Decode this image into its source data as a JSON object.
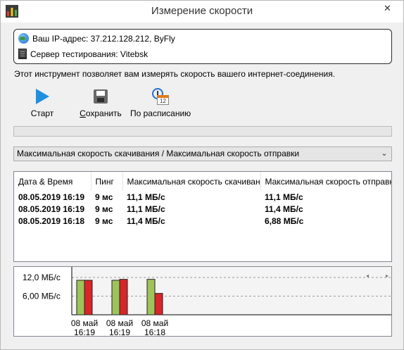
{
  "window": {
    "title": "Измерение скорости",
    "close_glyph": "✕"
  },
  "info": {
    "ip_label": "Ваш IP-адрес: 37.212.128.212, ByFly",
    "server_label": "Сервер тестирования: Vitebsk"
  },
  "description": "Этот инструмент позволяет вам измерять скорость вашего интернет-соединения.",
  "toolbar": {
    "start": "Старт",
    "save": "Сохранить",
    "schedule": "По расписанию",
    "schedule_icon_number": "12"
  },
  "progress": {
    "value": 0
  },
  "chart_selector": {
    "selected": "Максимальная скорость скачивания / Максимальная скорость отправки"
  },
  "table": {
    "headers": [
      "Дата & Время",
      "Пинг",
      "Максимальная скорость скачивания",
      "Максимальная скорость отправки"
    ],
    "rows": [
      [
        "08.05.2019 16:19",
        "9 мс",
        "11,1 МБ/с",
        "11,1 МБ/с"
      ],
      [
        "08.05.2019 16:19",
        "9 мс",
        "11,1 МБ/с",
        "11,4 МБ/с"
      ],
      [
        "08.05.2019 16:18",
        "9 мс",
        "11,4 МБ/с",
        "6,88 МБ/с"
      ]
    ]
  },
  "chart_data": {
    "type": "bar",
    "categories": [
      [
        "08 май",
        "16:19"
      ],
      [
        "08 май",
        "16:19"
      ],
      [
        "08 май",
        "16:18"
      ]
    ],
    "series": [
      {
        "values": [
          11.1,
          11.1,
          11.4
        ],
        "color": "#9fc25a"
      },
      {
        "values": [
          11.1,
          11.4,
          6.88
        ],
        "color": "#d8252a"
      }
    ],
    "y_ticks": [
      "12,0 МБ/с",
      "6,00 МБ/с"
    ],
    "y_tick_values": [
      12.0,
      6.0
    ],
    "ylim": [
      0,
      12.0
    ],
    "grid": true
  }
}
